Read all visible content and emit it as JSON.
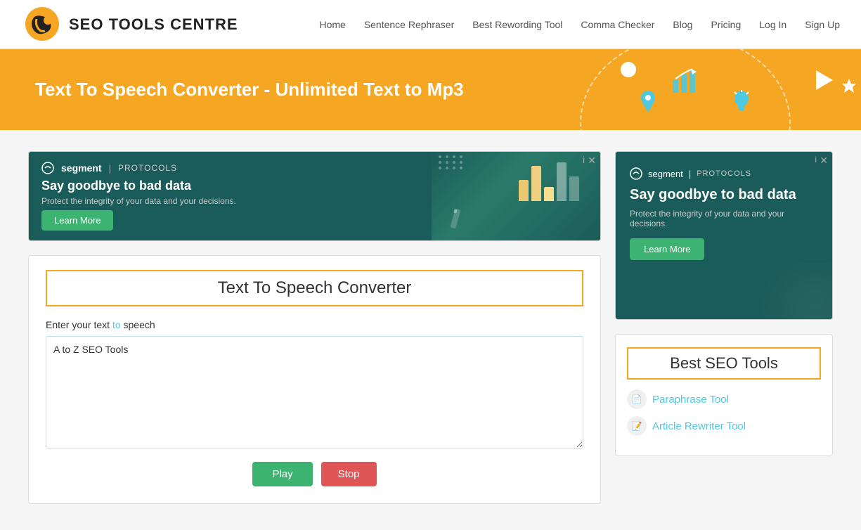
{
  "navbar": {
    "logo_text": "SEO TOOLS CENTRE",
    "links": [
      {
        "label": "Home",
        "href": "#"
      },
      {
        "label": "Sentence Rephraser",
        "href": "#"
      },
      {
        "label": "Best Rewording Tool",
        "href": "#"
      },
      {
        "label": "Comma Checker",
        "href": "#"
      },
      {
        "label": "Blog",
        "href": "#"
      },
      {
        "label": "Pricing",
        "href": "#"
      },
      {
        "label": "Log In",
        "href": "#"
      },
      {
        "label": "Sign Up",
        "href": "#"
      }
    ]
  },
  "hero": {
    "title": "Text To Speech Converter - Unlimited Text to Mp3"
  },
  "ad_banner": {
    "brand": "segment",
    "divider": "|",
    "protocols": "PROTOCOLS",
    "headline": "Say goodbye to bad data",
    "subtext": "Protect the integrity of your data and your decisions.",
    "btn_label": "Learn More",
    "close_label": "i",
    "close_x": "✕"
  },
  "tool": {
    "title": "Text To Speech Converter",
    "label_text": "Enter your text to speech",
    "label_highlight": "to",
    "textarea_value": "A to Z SEO Tools",
    "btn_play": "Play",
    "btn_stop": "Stop"
  },
  "right_ad": {
    "brand": "segment",
    "protocols": "PROTOCOLS",
    "headline": "Say goodbye to bad data",
    "subtext": "Protect the integrity of your data and your decisions.",
    "btn_label": "Learn More",
    "close_label": "i",
    "close_x": "✕"
  },
  "best_seo": {
    "title": "Best SEO Tools",
    "links": [
      {
        "label": "Paraphrase Tool",
        "icon": "📄"
      },
      {
        "label": "Article Rewriter Tool",
        "icon": "📝"
      }
    ]
  }
}
